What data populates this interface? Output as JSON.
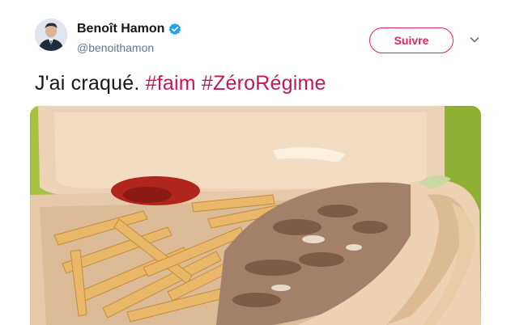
{
  "user": {
    "display_name": "Benoît Hamon",
    "handle": "@benoithamon",
    "avatar_icon": "profile-photo",
    "verified_icon": "verified-badge-icon"
  },
  "actions": {
    "follow_label": "Suivre",
    "more_icon": "chevron-down-icon"
  },
  "tweet": {
    "text_plain": "J'ai craqué.",
    "hashtags": [
      "#faim",
      "#ZéroRégime"
    ]
  },
  "media": {
    "description_icon": "food-photo"
  },
  "colors": {
    "accent": "#e0245e",
    "hashtag": "#c2185b",
    "verified": "#1da1f2",
    "text": "#14171a",
    "muted": "#657786"
  }
}
